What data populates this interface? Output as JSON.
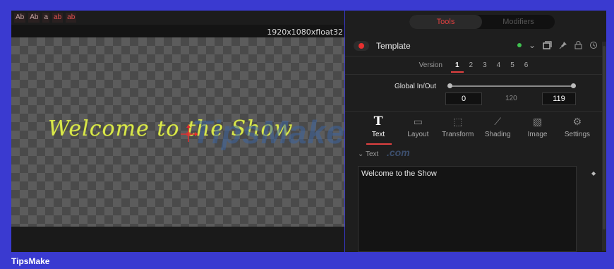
{
  "viewer": {
    "toolbar": [
      "Ab",
      "Ab",
      "a",
      "ab",
      "ab"
    ],
    "resolution": "1920x1080xfloat32",
    "canvas_text": "Welcome to the Show"
  },
  "inspector": {
    "tabs": [
      "Tools",
      "Modifiers"
    ],
    "tool_name": "Template",
    "version_label": "Version",
    "versions": [
      "1",
      "2",
      "3",
      "4",
      "5",
      "6"
    ],
    "global_label": "Global In/Out",
    "global_in": "0",
    "global_mid": "120",
    "global_out": "119",
    "tool_tabs": [
      {
        "label": "Text",
        "icon": "T"
      },
      {
        "label": "Layout",
        "icon": "layout-icon"
      },
      {
        "label": "Transform",
        "icon": "transform-icon"
      },
      {
        "label": "Shading",
        "icon": "shading-icon"
      },
      {
        "label": "Image",
        "icon": "image-icon"
      },
      {
        "label": "Settings",
        "icon": "settings-icon"
      }
    ],
    "section_label": "Text",
    "text_value": "Welcome to the Show"
  },
  "watermark": {
    "main": "TipsMake",
    "sub": ".com"
  },
  "footer": "TipsMake",
  "colors": {
    "accent": "#e04040",
    "frame": "#3a3ad0",
    "text_yellow": "#d9e84a"
  }
}
